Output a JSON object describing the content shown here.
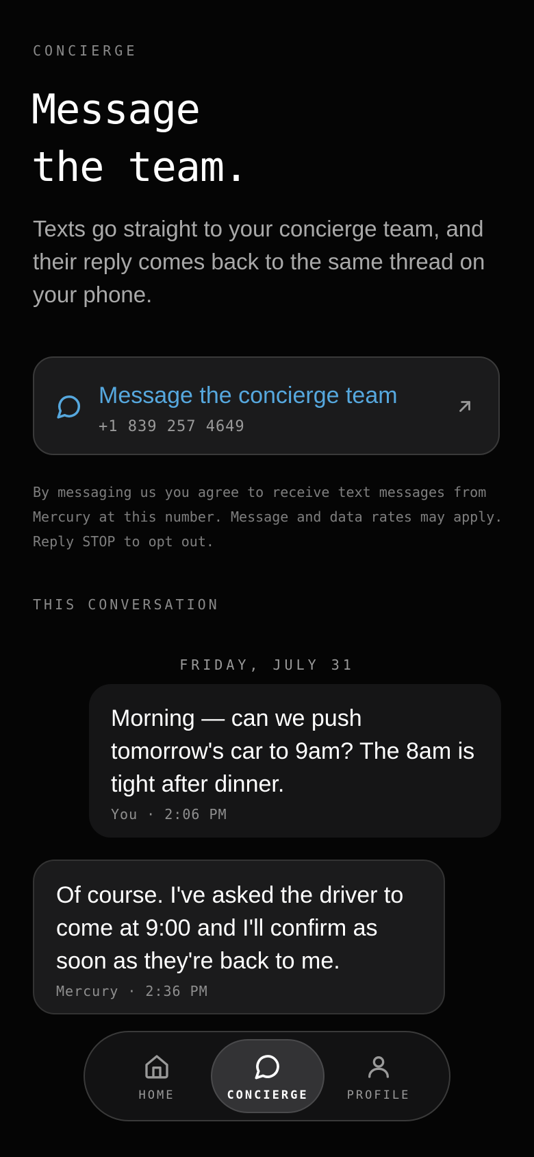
{
  "header": {
    "eyebrow": "CONCIERGE",
    "title_line1": "Message",
    "title_line2": "the team.",
    "intro": "Texts go straight to your concierge team, and their reply comes back to the same thread on your phone."
  },
  "cta": {
    "label": "Message the concierge team",
    "phone": "+1 839 257 4649",
    "icon": "chat-bubble-icon",
    "trailing_icon": "arrow-up-right-icon",
    "accent_color": "#56a8de"
  },
  "disclaimer": "By messaging us you agree to receive text messages from Mercury at this number. Message and data rates may apply. Reply STOP to opt out.",
  "conversation": {
    "section_label": "THIS CONVERSATION",
    "date": "FRIDAY, JULY 31",
    "messages": [
      {
        "direction": "outgoing",
        "text": "Morning — can we push tomorrow's car to 9am? The 8am is tight after dinner.",
        "meta": "You · 2:06 PM"
      },
      {
        "direction": "incoming",
        "text": "Of course. I've asked the driver to come at 9:00 and I'll confirm as soon as they're back to me.",
        "meta": "Mercury · 2:36 PM"
      }
    ]
  },
  "tabbar": {
    "active": "concierge",
    "tabs": [
      {
        "id": "home",
        "label": "HOME",
        "icon": "home-icon"
      },
      {
        "id": "concierge",
        "label": "CONCIERGE",
        "icon": "chat-bubble-icon"
      },
      {
        "id": "profile",
        "label": "PROFILE",
        "icon": "person-icon"
      }
    ]
  }
}
